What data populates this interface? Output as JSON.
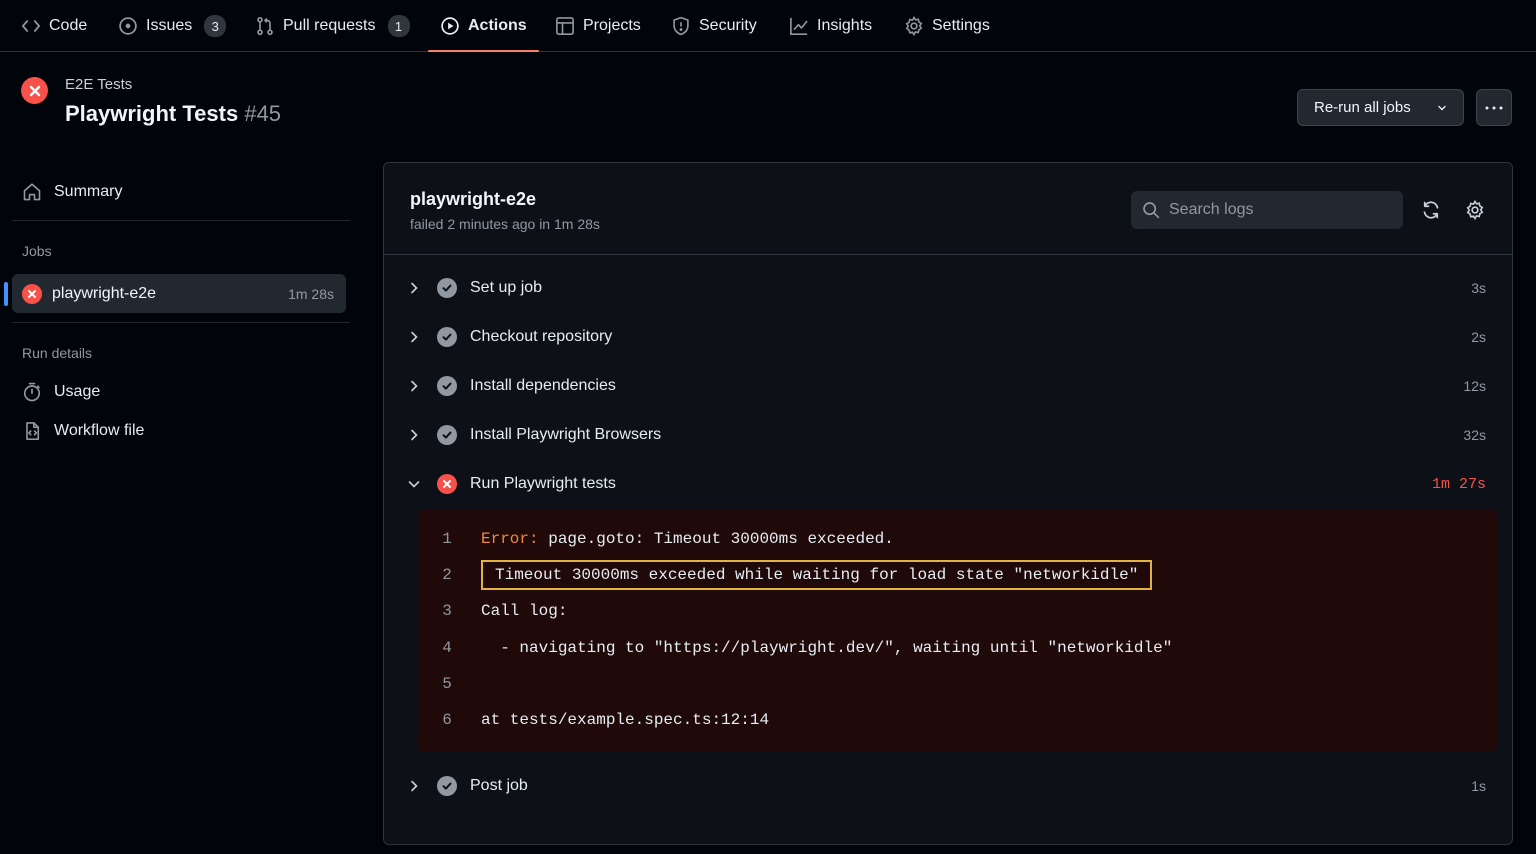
{
  "nav": {
    "tabs": [
      {
        "label": "Code",
        "icon": "code-icon"
      },
      {
        "label": "Issues",
        "count": "3",
        "icon": "issue-icon"
      },
      {
        "label": "Pull requests",
        "count": "1",
        "icon": "pull-request-icon"
      },
      {
        "label": "Actions",
        "icon": "play-icon"
      },
      {
        "label": "Projects",
        "icon": "table-icon"
      },
      {
        "label": "Security",
        "icon": "shield-icon"
      },
      {
        "label": "Insights",
        "icon": "graph-icon"
      },
      {
        "label": "Settings",
        "icon": "gear-icon"
      }
    ],
    "active_tab": "Actions"
  },
  "run": {
    "workflow": "E2E Tests",
    "title": "Playwright Tests",
    "number": "#45",
    "status": "failed",
    "rerun_label": "Re-run all jobs"
  },
  "sidebar": {
    "summary_label": "Summary",
    "jobs_heading": "Jobs",
    "job": {
      "name": "playwright-e2e",
      "duration": "1m 28s"
    },
    "run_details_heading": "Run details",
    "usage_label": "Usage",
    "workflow_file_label": "Workflow file"
  },
  "job": {
    "name": "playwright-e2e",
    "subtitle": "failed 2 minutes ago in 1m 28s",
    "search_placeholder": "Search logs",
    "steps": [
      {
        "name": "Set up job",
        "time": "3s",
        "status": "success"
      },
      {
        "name": "Checkout repository",
        "time": "2s",
        "status": "success"
      },
      {
        "name": "Install dependencies",
        "time": "12s",
        "status": "success"
      },
      {
        "name": "Install Playwright Browsers",
        "time": "32s",
        "status": "success"
      },
      {
        "name": "Run Playwright tests",
        "time": "1m 27s",
        "status": "failure",
        "expanded": true
      },
      {
        "name": "Post job",
        "time": "1s",
        "status": "success"
      }
    ],
    "log": {
      "line1_prefix": "Error:",
      "line1_rest": " page.goto: Timeout 30000ms exceeded.",
      "line2": "Timeout 30000ms exceeded while waiting for load state \"networkidle\"",
      "line3": "Call log:",
      "line4": "  - navigating to \"https://playwright.dev/\", waiting until \"networkidle\"",
      "line5": "",
      "line6": "at tests/example.spec.ts:12:14",
      "numbers": [
        "1",
        "2",
        "3",
        "4",
        "5",
        "6"
      ]
    }
  },
  "colors": {
    "accent_underline": "#f78166",
    "failure": "#f85149",
    "highlight_border": "#e3b341",
    "log_background": "#1f0909"
  }
}
